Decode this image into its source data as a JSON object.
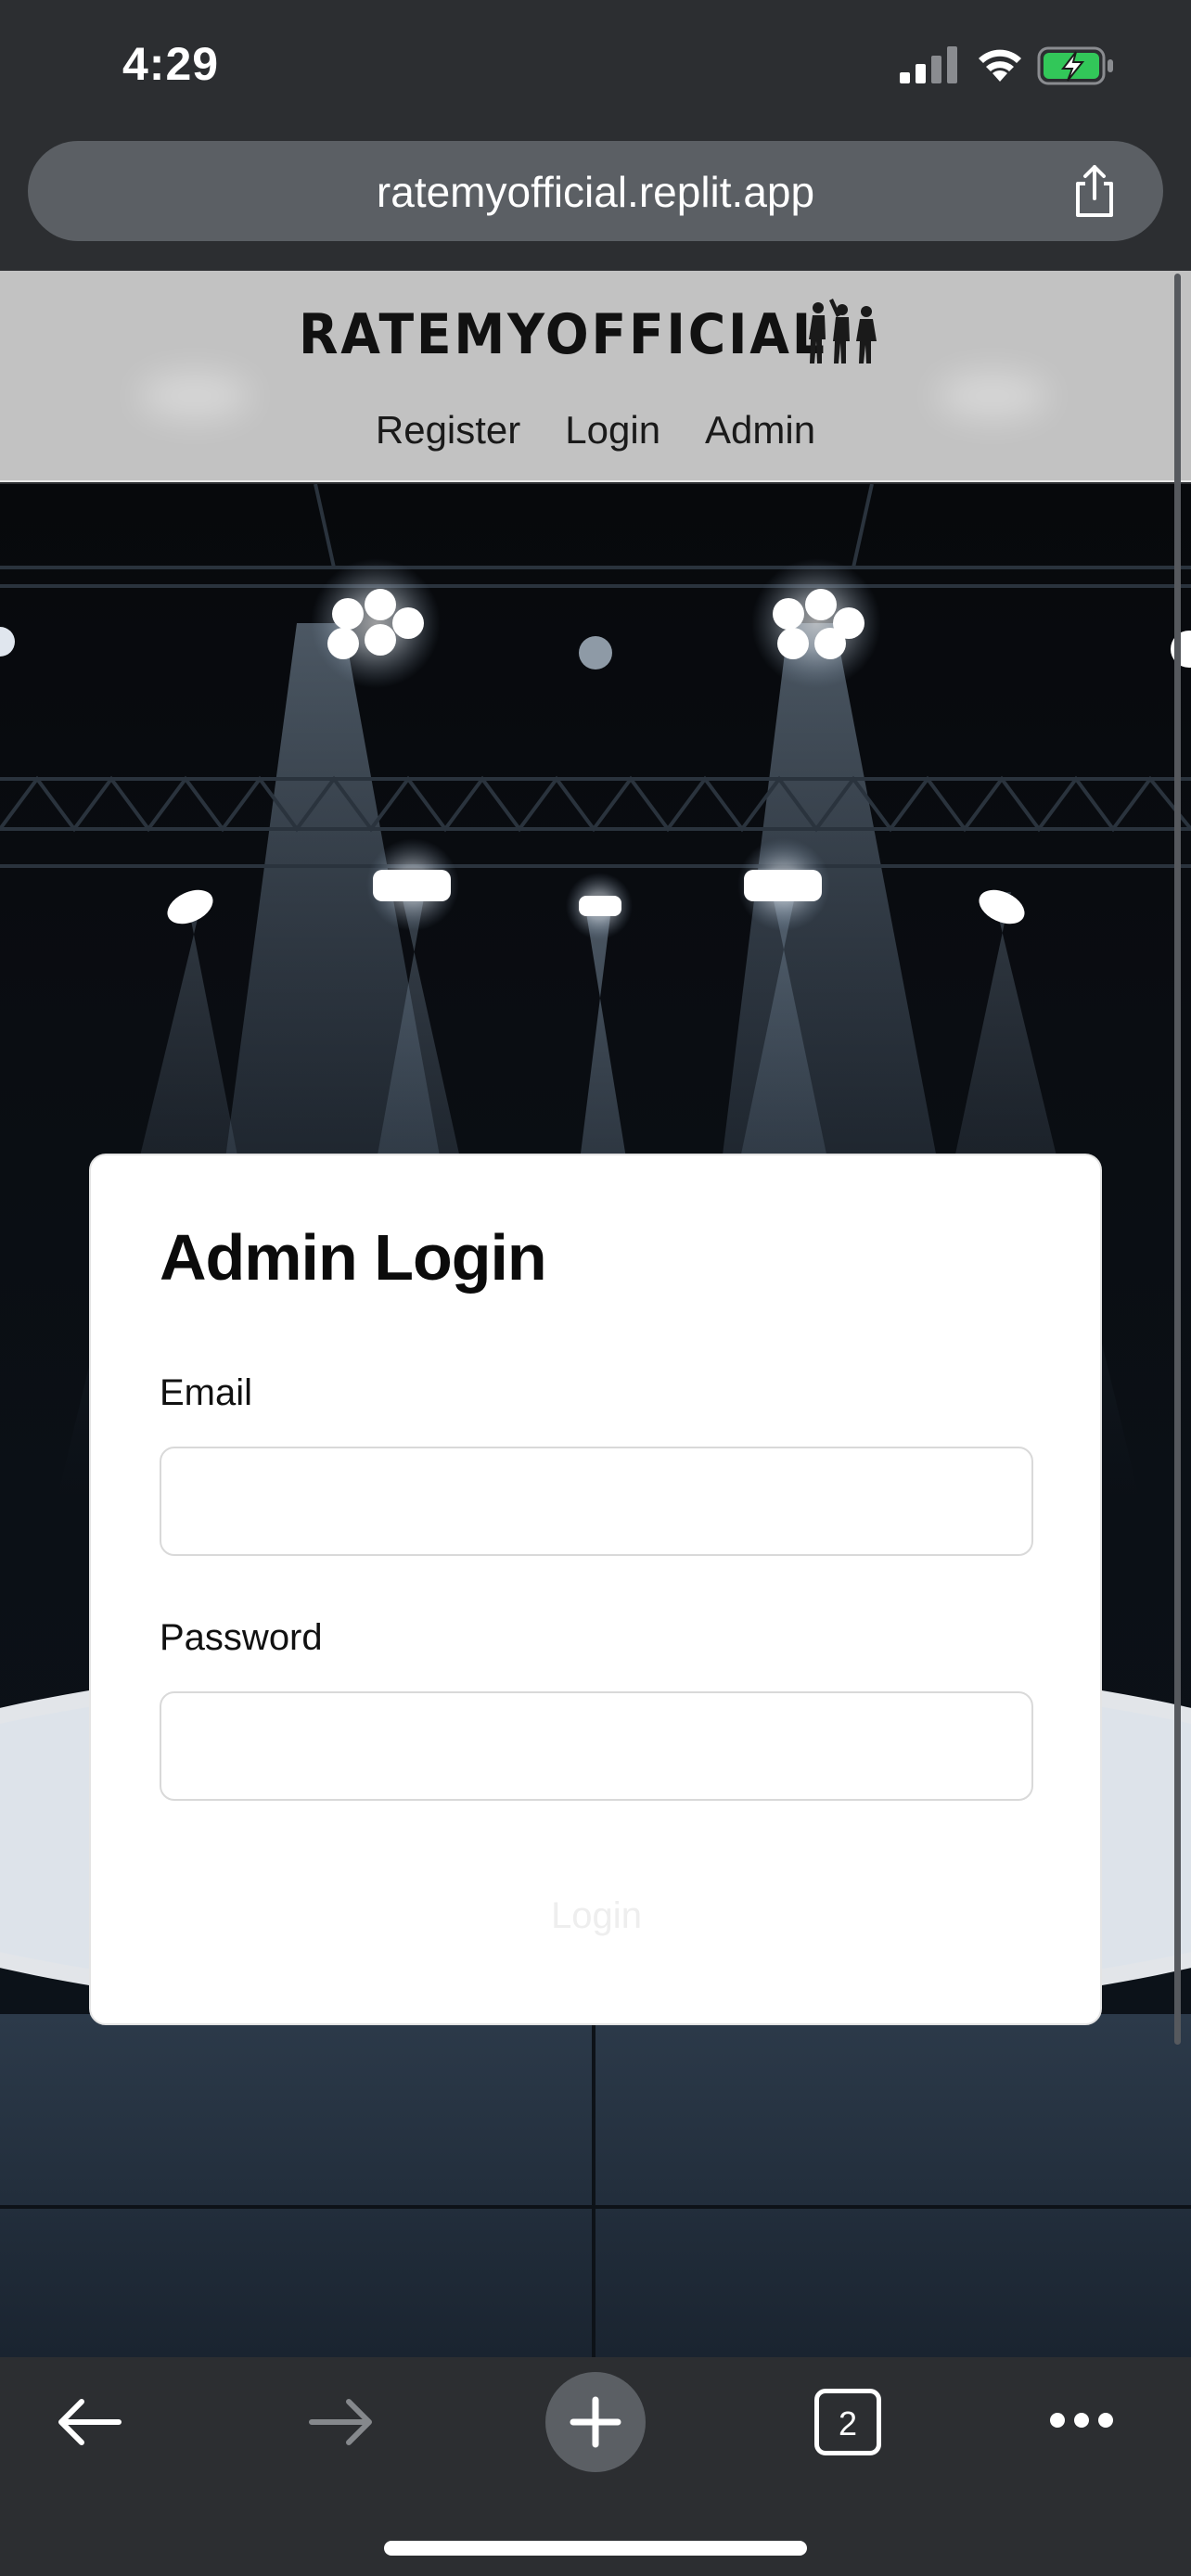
{
  "status_bar": {
    "time": "4:29",
    "icons": [
      "cellular-signal-icon",
      "wifi-icon",
      "battery-charging-icon"
    ]
  },
  "browser": {
    "url": "ratemyofficial.replit.app",
    "share_icon": "share-icon",
    "tab_count": "2",
    "toolbar_icons": [
      "back-arrow-icon",
      "forward-arrow-icon",
      "new-tab-plus-icon",
      "tabs-icon",
      "more-icon"
    ]
  },
  "site": {
    "logo_text": "RATEMYOFFICIAL",
    "logo_icon": "referee-silhouettes-icon",
    "nav": [
      "Register",
      "Login",
      "Admin"
    ]
  },
  "login_card": {
    "title": "Admin Login",
    "email_label": "Email",
    "email_value": "",
    "password_label": "Password",
    "password_value": "",
    "submit_label": "Login"
  },
  "colors": {
    "chrome": "#2c2e31",
    "url_bar": "#5b5f64",
    "header_bg": "#c2c2c2",
    "card_bg": "#ffffff",
    "battery_green": "#32c759"
  }
}
